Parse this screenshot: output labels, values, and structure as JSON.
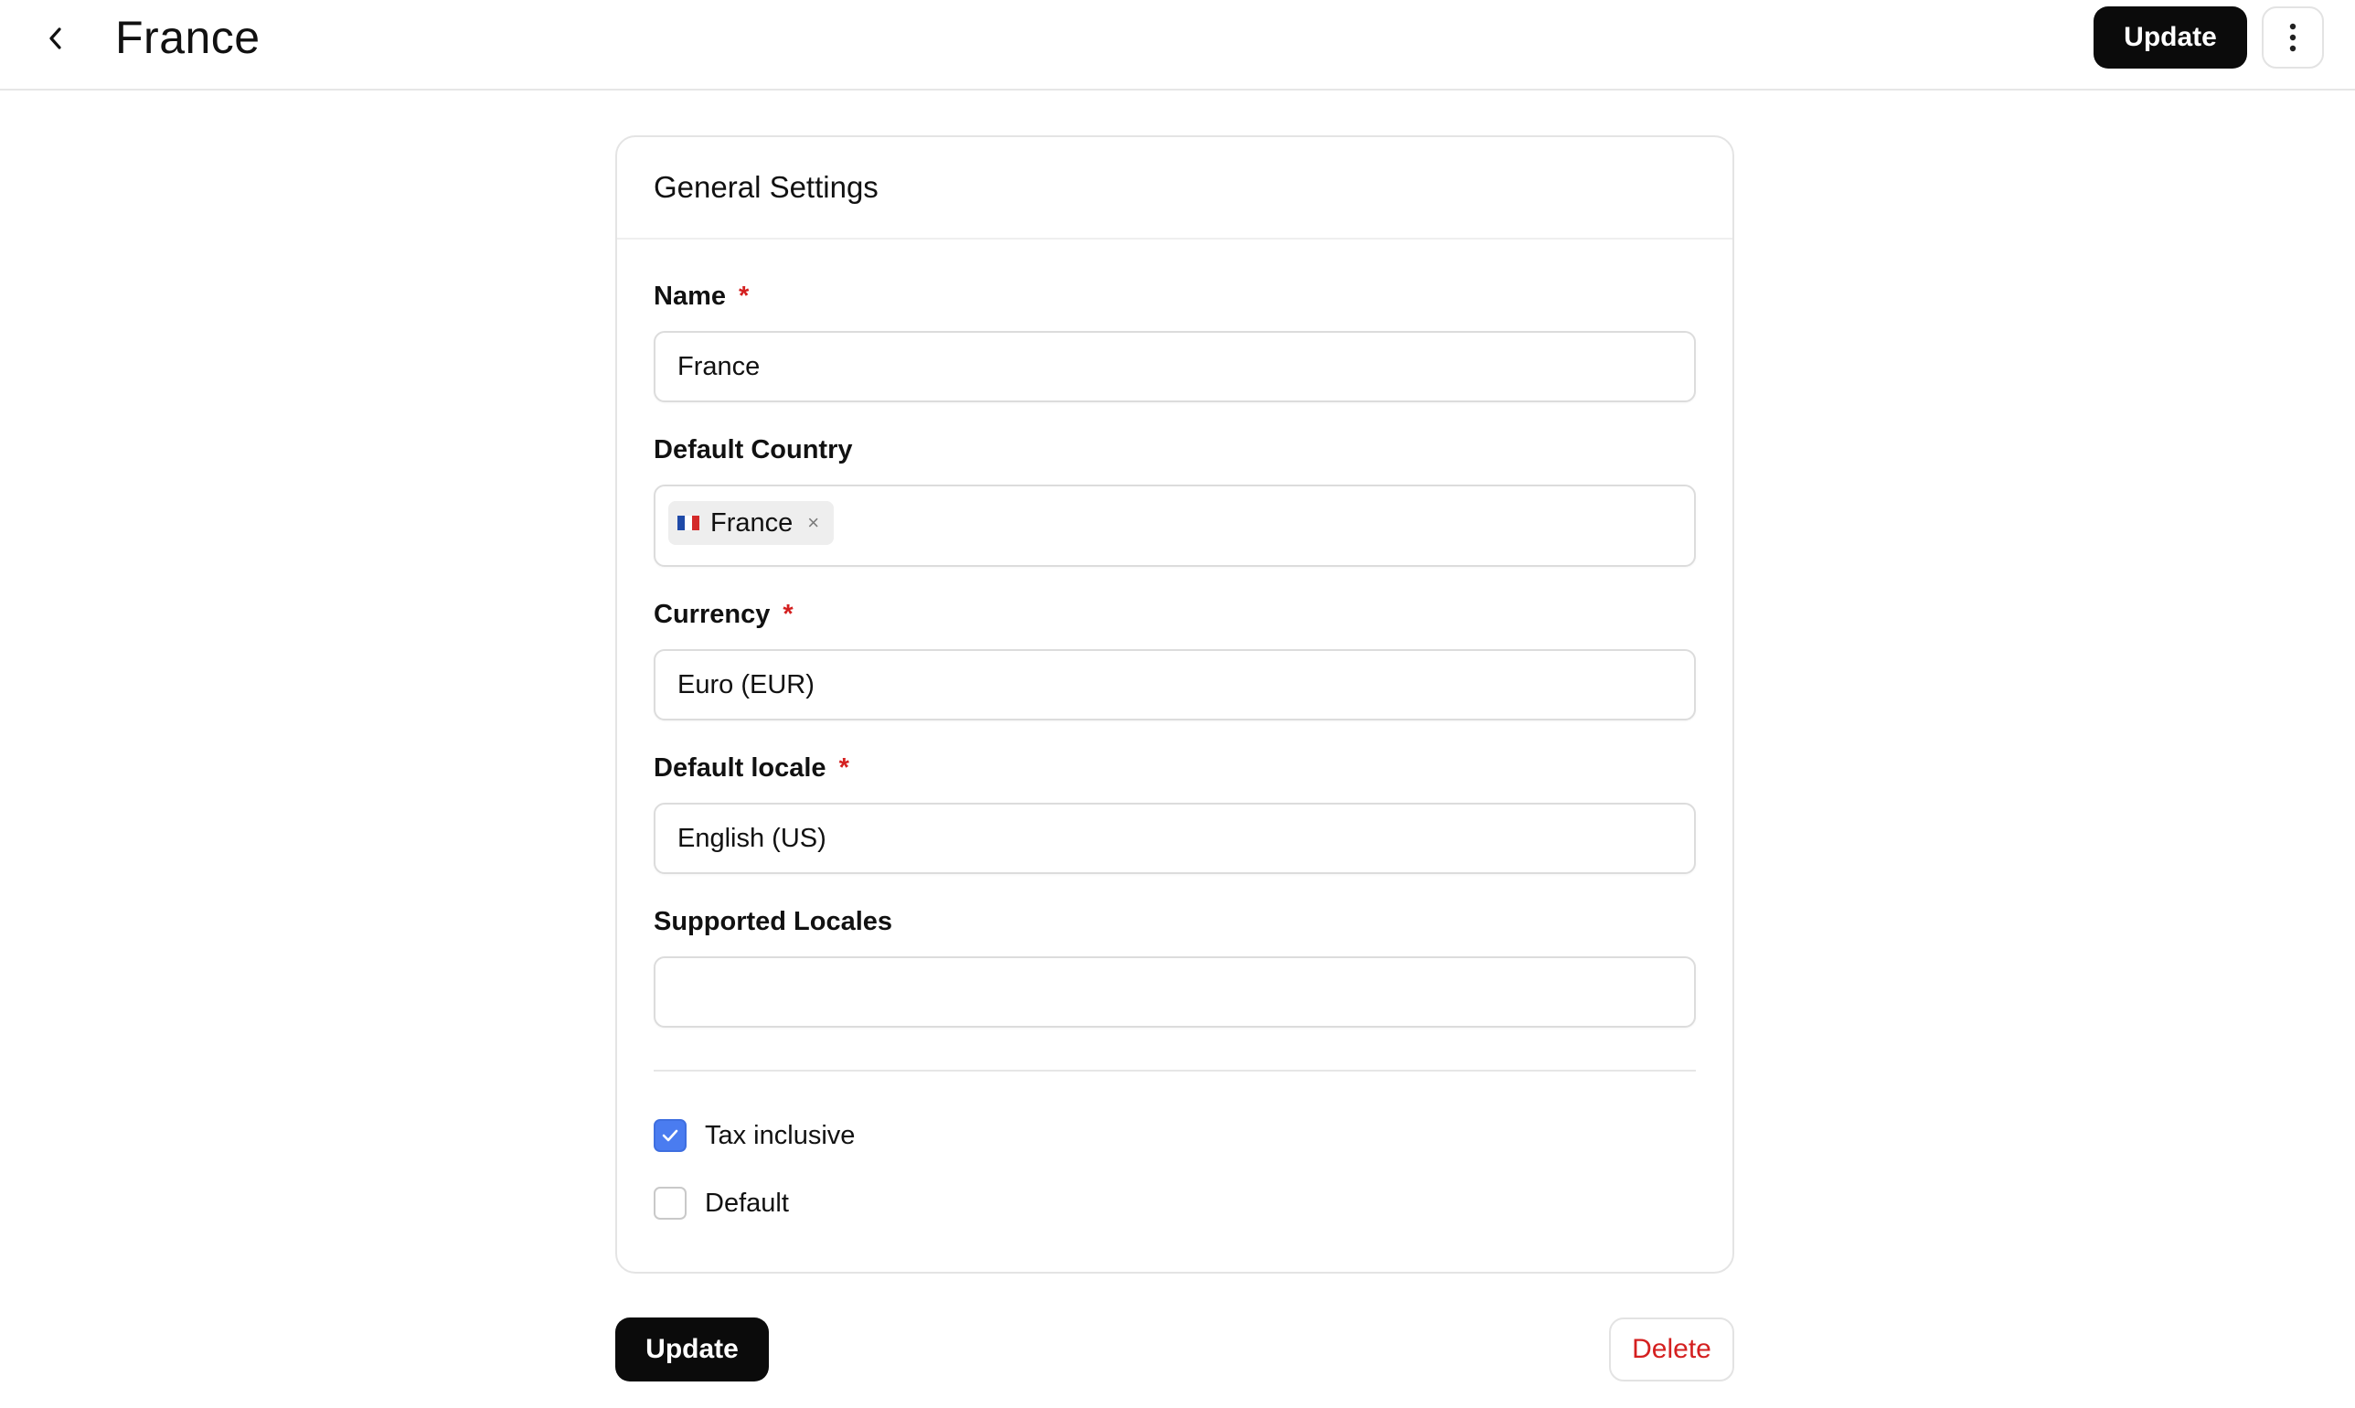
{
  "header": {
    "title": "France",
    "update_label": "Update",
    "back_icon": "chevron-left-icon",
    "more_icon": "more-vertical-icon"
  },
  "card": {
    "title": "General Settings",
    "fields": {
      "name": {
        "label": "Name",
        "required_mark": "*",
        "value": "France"
      },
      "default_country": {
        "label": "Default Country",
        "chip_label": "France",
        "chip_remove": "×",
        "flag_colors": [
          "#1f4aa8",
          "#ffffff",
          "#d42a2a"
        ]
      },
      "currency": {
        "label": "Currency",
        "required_mark": "*",
        "value": "Euro (EUR)"
      },
      "default_locale": {
        "label": "Default locale",
        "required_mark": "*",
        "value": "English (US)"
      },
      "supported_locales": {
        "label": "Supported Locales",
        "value": ""
      }
    },
    "checkboxes": {
      "tax_inclusive": {
        "label": "Tax inclusive",
        "checked": true
      },
      "default": {
        "label": "Default",
        "checked": false
      }
    }
  },
  "footer": {
    "update_label": "Update",
    "delete_label": "Delete"
  },
  "colors": {
    "primary_button": "#0b0b0b",
    "danger_text": "#d42020",
    "checkbox_checked": "#4a7cf0",
    "required": "#d42020"
  }
}
